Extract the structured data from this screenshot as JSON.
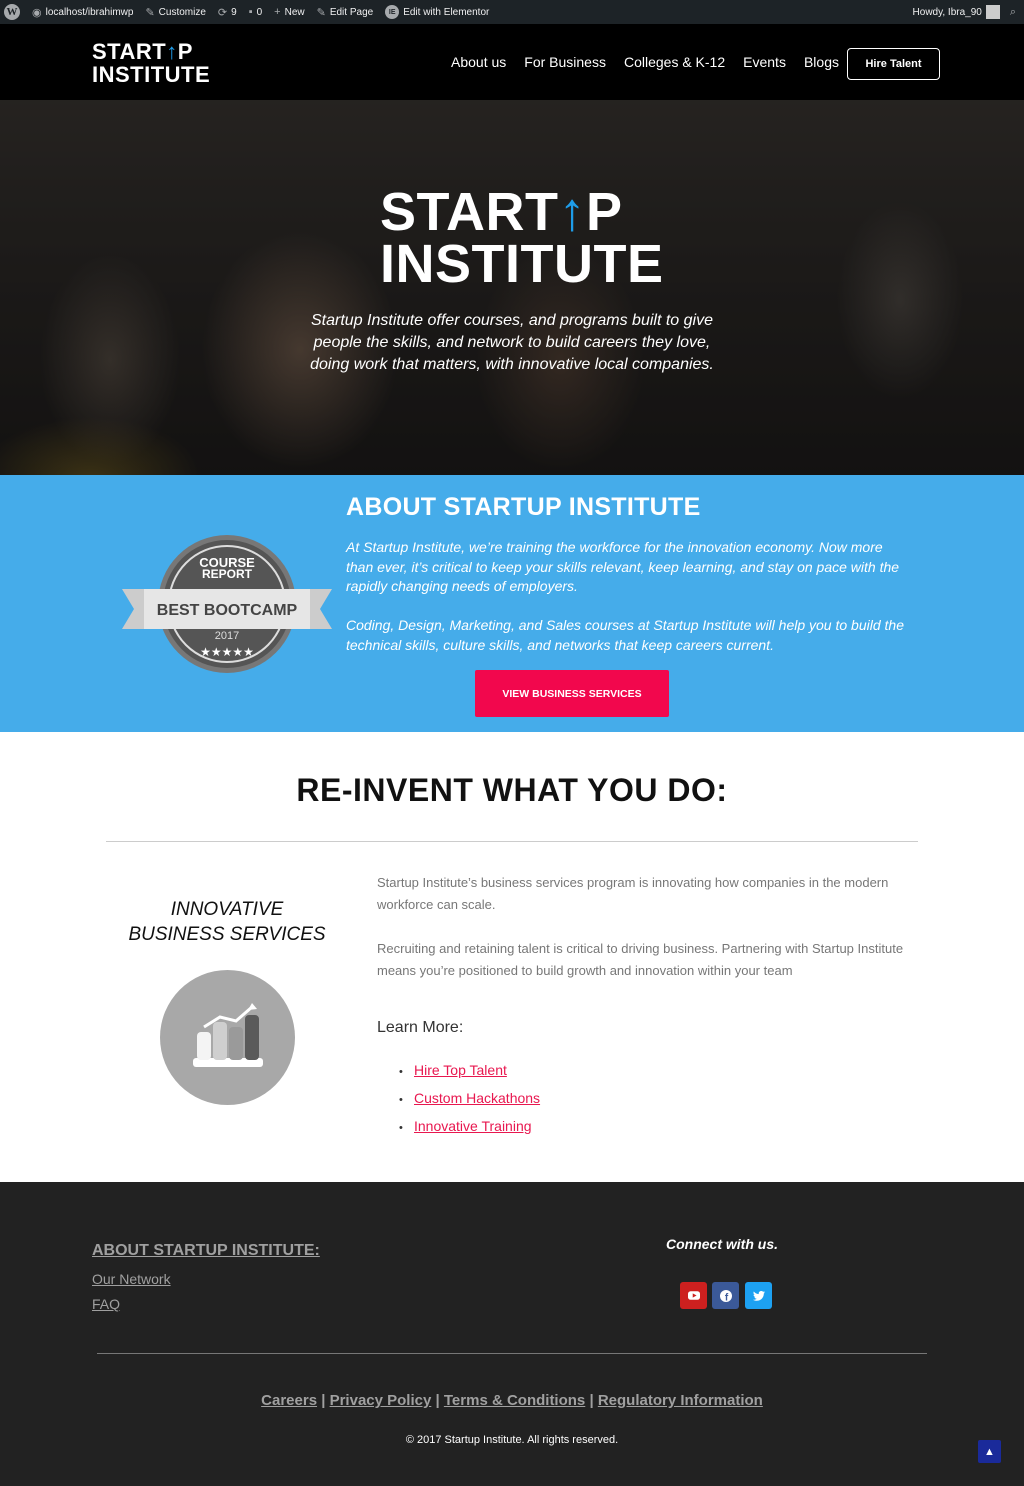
{
  "adminbar": {
    "site": "localhost/ibrahimwp",
    "customize": "Customize",
    "updates_count": "9",
    "comments_count": "0",
    "new_label": "New",
    "edit_page": "Edit Page",
    "edit_elementor": "Edit with Elementor",
    "greeting": "Howdy, Ibra_90"
  },
  "logo": {
    "line1_a": "START",
    "line1_b": "P",
    "line2": "INSTITUTE"
  },
  "nav": {
    "items": [
      "About us",
      "For Business",
      "Colleges & K-12",
      "Events",
      "Blogs"
    ]
  },
  "hire_button": "Hire Talent",
  "hero": {
    "text": "Startup Institute offer courses, and programs built to give people the skills, and network to build careers they love, doing work that matters, with innovative local companies."
  },
  "about": {
    "title": "ABOUT STARTUP INSTITUTE",
    "p1": "At Startup Institute, we’re training the workforce for the innovation economy. Now more than ever, it’s critical to keep your skills relevant, keep learning, and stay on pace with the rapidly changing needs of employers.",
    "p2": "Coding, Design, Marketing, and Sales courses at Startup Institute will help you to build the technical skills, culture skills, and networks that keep careers current.",
    "button": "VIEW BUSINESS SERVICES",
    "badge": {
      "top1": "COURSE",
      "top2": "REPORT",
      "ribbon": "BEST BOOTCAMP",
      "year": "2017"
    }
  },
  "reinvent": {
    "title": "RE-INVENT WHAT YOU DO:",
    "innov_line1": "INNOVATIVE",
    "innov_line2": "BUSINESS SERVICES",
    "p1": "Startup Institute’s business services program is innovating how companies in the modern workforce can scale.",
    "p2": "Recruiting and retaining talent is critical to driving business. Partnering with Startup Institute means you’re positioned to build growth and innovation within your team",
    "learn_more": "Learn More:",
    "links": [
      "Hire Top Talent",
      "Custom Hackathons",
      "Innovative Training"
    ]
  },
  "footer": {
    "about_heading": "ABOUT STARTUP INSTITUTE:",
    "network": "Our Network",
    "faq": "FAQ",
    "connect": "Connect with us.",
    "links": [
      "Careers",
      "Privacy Policy",
      "Terms & Conditions",
      "Regulatory Information"
    ],
    "separator": "|",
    "copyright": "© 2017 Startup Institute. All rights reserved."
  },
  "colors": {
    "accent_blue": "#45acea",
    "cta_pink": "#f2074d",
    "logo_arrow": "#1e9ce8"
  }
}
